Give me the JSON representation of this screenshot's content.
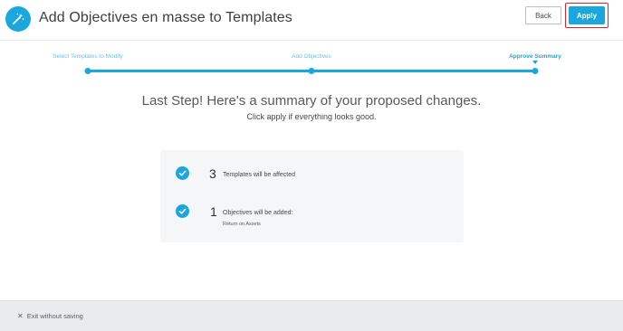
{
  "header": {
    "title": "Add Objectives en masse to Templates",
    "icon": "magic-wand-icon",
    "accent_color": "#1ba7de"
  },
  "stepper": {
    "steps": [
      {
        "label": "Select Templates to Modify",
        "state": "complete"
      },
      {
        "label": "Add Objectives",
        "state": "complete"
      },
      {
        "label": "Approve Summary",
        "state": "active"
      }
    ]
  },
  "summary": {
    "title": "Last Step! Here's a summary of your proposed changes.",
    "subtitle": "Click apply if everything looks good.",
    "items": [
      {
        "count": "3",
        "text": "Templates will be affected",
        "detail": ""
      },
      {
        "count": "1",
        "text": "Objectives will be added:",
        "detail": "Return on Assets"
      }
    ]
  },
  "footer": {
    "exit_label": "Exit without saving",
    "back_label": "Back",
    "apply_label": "Apply"
  }
}
